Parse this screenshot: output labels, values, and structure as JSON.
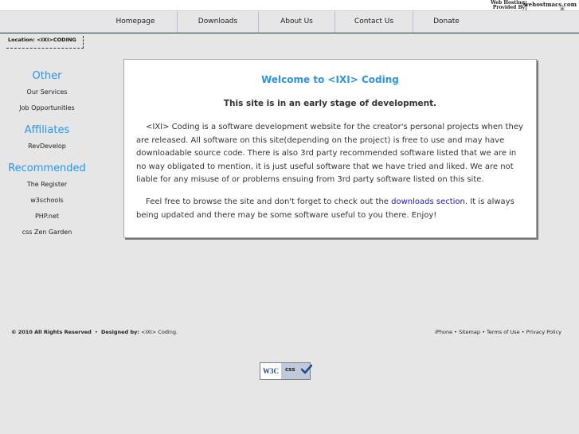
{
  "hosting": {
    "line1": "Web Hosting",
    "line2": "Provided By",
    "brand": "wehostmacs.com"
  },
  "nav": {
    "items": [
      {
        "label": "Homepage"
      },
      {
        "label": "Downloads"
      },
      {
        "label": "About Us"
      },
      {
        "label": "Contact Us"
      },
      {
        "label": "Donate"
      }
    ]
  },
  "location": "Location: <IXI>CODING",
  "sidebar": {
    "other_heading": "Other",
    "other_items": [
      "Our Services",
      "Job Opportunities"
    ],
    "affiliates_heading": "Affiliates",
    "affiliates_items": [
      "RevDevelop"
    ],
    "recommended_heading": "Recommended",
    "recommended_items": [
      "The Register",
      "w3schools",
      "PHP.net",
      "css Zen Garden"
    ]
  },
  "content": {
    "title": "Welcome to <IXI> Coding",
    "subtitle": "This site is in an early stage of development.",
    "para1": "<IXI> Coding is a software development website for the creator's personal projects when they are released. All software on this site(depending on the project) is free to use and may have downloadable source code. There is also 3rd party recommended software listed that we are in no way obligated to mention, it is just useful software that we have tried and liked. We are not liable for any misuse of or problems ensuing from 3rd party software listed on this site.",
    "para2_before": "Feel free to browse the site and don't forget to check out the ",
    "para2_link": "downloads section",
    "para2_after": ". It is always being updated and there may be some software useful to you there. Enjoy!"
  },
  "footer": {
    "copyright": "© 2010 All Rights Reserved",
    "sep": "•",
    "designed_label": "Designed by:",
    "designer": "<IXI> Coding.",
    "links": [
      "iPhone",
      "Sitemap",
      "Terms of Use",
      "Privacy Policy"
    ]
  },
  "badge": {
    "w3c": "W3C",
    "css": "css"
  },
  "colors": {
    "accent": "#2a94e8",
    "link": "#1b1bd0",
    "background": "#e6e6e6"
  }
}
